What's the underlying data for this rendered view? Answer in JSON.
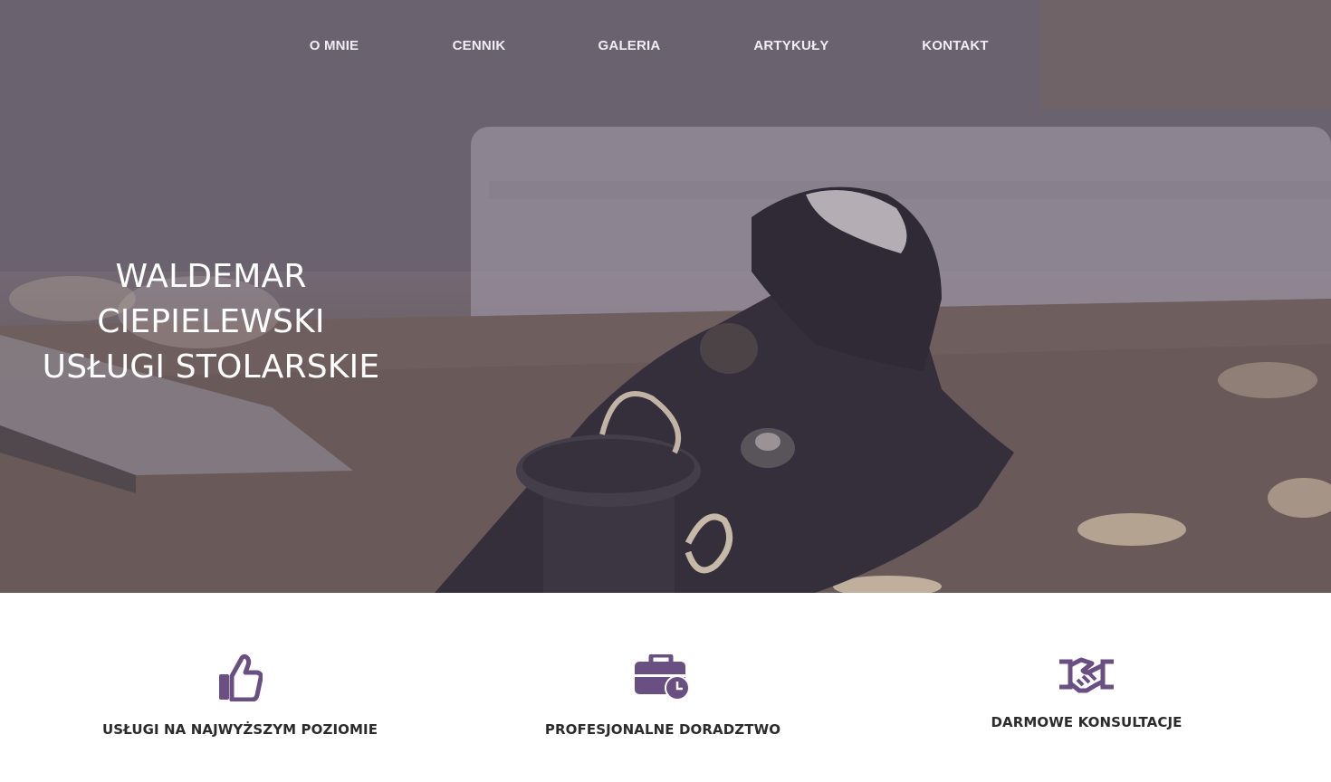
{
  "nav": {
    "items": [
      {
        "label": "O MNIE"
      },
      {
        "label": "CENNIK"
      },
      {
        "label": "GALERIA"
      },
      {
        "label": "ARTYKUŁY"
      },
      {
        "label": "KONTAKT"
      }
    ]
  },
  "hero": {
    "title_line1": "WALDEMAR CIEPIELEWSKI",
    "title_line2": "USŁUGI STOLARSKIE",
    "background_image": "hand-plane-on-workbench-photo"
  },
  "features": [
    {
      "icon": "thumbs-up-icon",
      "label": "USŁUGI NA NAJWYŻSZYM POZIOMIE"
    },
    {
      "icon": "briefcase-clock-icon",
      "label": "PROFESJONALNE DORADZTWO"
    },
    {
      "icon": "handshake-icon",
      "label": "DARMOWE KONSULTACJE"
    }
  ],
  "colors": {
    "accent": "#6a4f82",
    "nav_text": "#f1eef2",
    "feature_text": "#2b2b2b"
  }
}
